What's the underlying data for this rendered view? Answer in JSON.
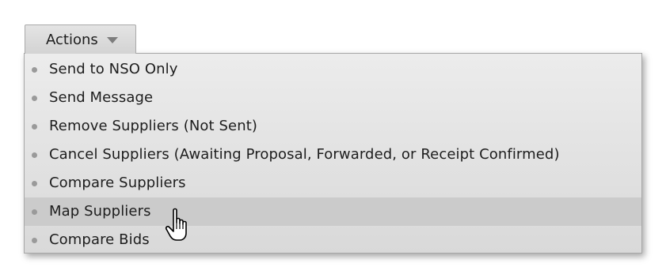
{
  "actions_button": {
    "label": "Actions",
    "icon": "dropdown-arrow-icon"
  },
  "menu": {
    "items": [
      {
        "label": "Send to NSO Only"
      },
      {
        "label": "Send Message"
      },
      {
        "label": "Remove Suppliers (Not Sent)"
      },
      {
        "label": "Cancel Suppliers (Awaiting Proposal, Forwarded, or Receipt Confirmed)"
      },
      {
        "label": "Compare Suppliers"
      },
      {
        "label": "Map Suppliers",
        "hovered": true
      },
      {
        "label": "Compare Bids"
      }
    ]
  },
  "cursor": {
    "icon": "hand-pointer-icon"
  },
  "colors": {
    "menu_bg": "#e3e3e3",
    "hover_bg": "#cbcbcb",
    "bullet": "#9a9a9a",
    "text": "#1d1d1d"
  }
}
